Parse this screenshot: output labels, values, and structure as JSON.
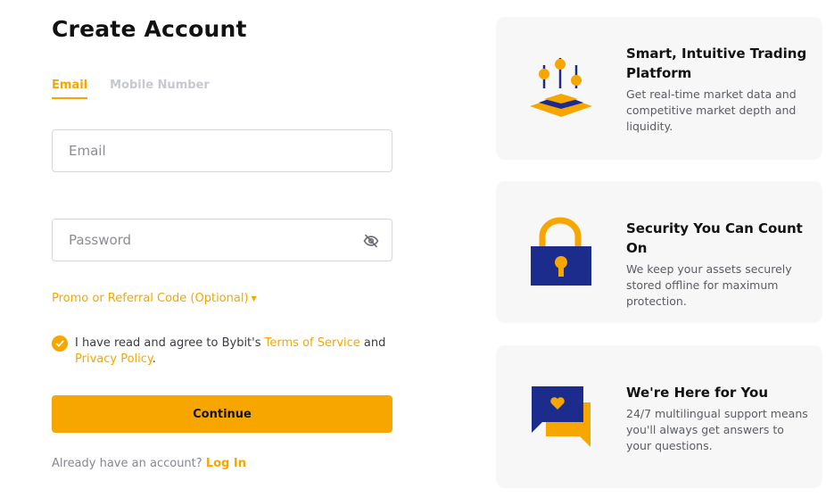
{
  "page": {
    "title": "Create Account"
  },
  "tabs": [
    {
      "label": "Email",
      "active": true
    },
    {
      "label": "Mobile Number",
      "active": false
    }
  ],
  "form": {
    "email_placeholder": "Email",
    "email_value": "",
    "password_placeholder": "Password",
    "password_value": "",
    "promo_label": "Promo or Referral Code (Optional)",
    "agree_prefix": "I have read and agree to Bybit's",
    "terms_link": "Terms of Service",
    "agree_and": "and",
    "privacy_link": "Privacy Policy",
    "agree_suffix": ".",
    "continue_label": "Continue",
    "login_prompt": "Already have an account?",
    "login_link": "Log In"
  },
  "features": [
    {
      "title": "Smart, Intuitive Trading Platform",
      "description": "Get real-time market data and competitive market depth and liquidity.",
      "icon": "trading-platform-icon"
    },
    {
      "title": "Security You Can Count On",
      "description": "We keep your assets securely stored offline for maximum protection.",
      "icon": "padlock-icon"
    },
    {
      "title": "We're Here for You",
      "description": "24/7 multilingual support means you'll always get answers to your questions.",
      "icon": "chat-heart-icon"
    }
  ],
  "colors": {
    "accent": "#f7a600",
    "navy": "#1b2c8c",
    "card_bg": "#f7f7f8",
    "text": "#121214"
  }
}
